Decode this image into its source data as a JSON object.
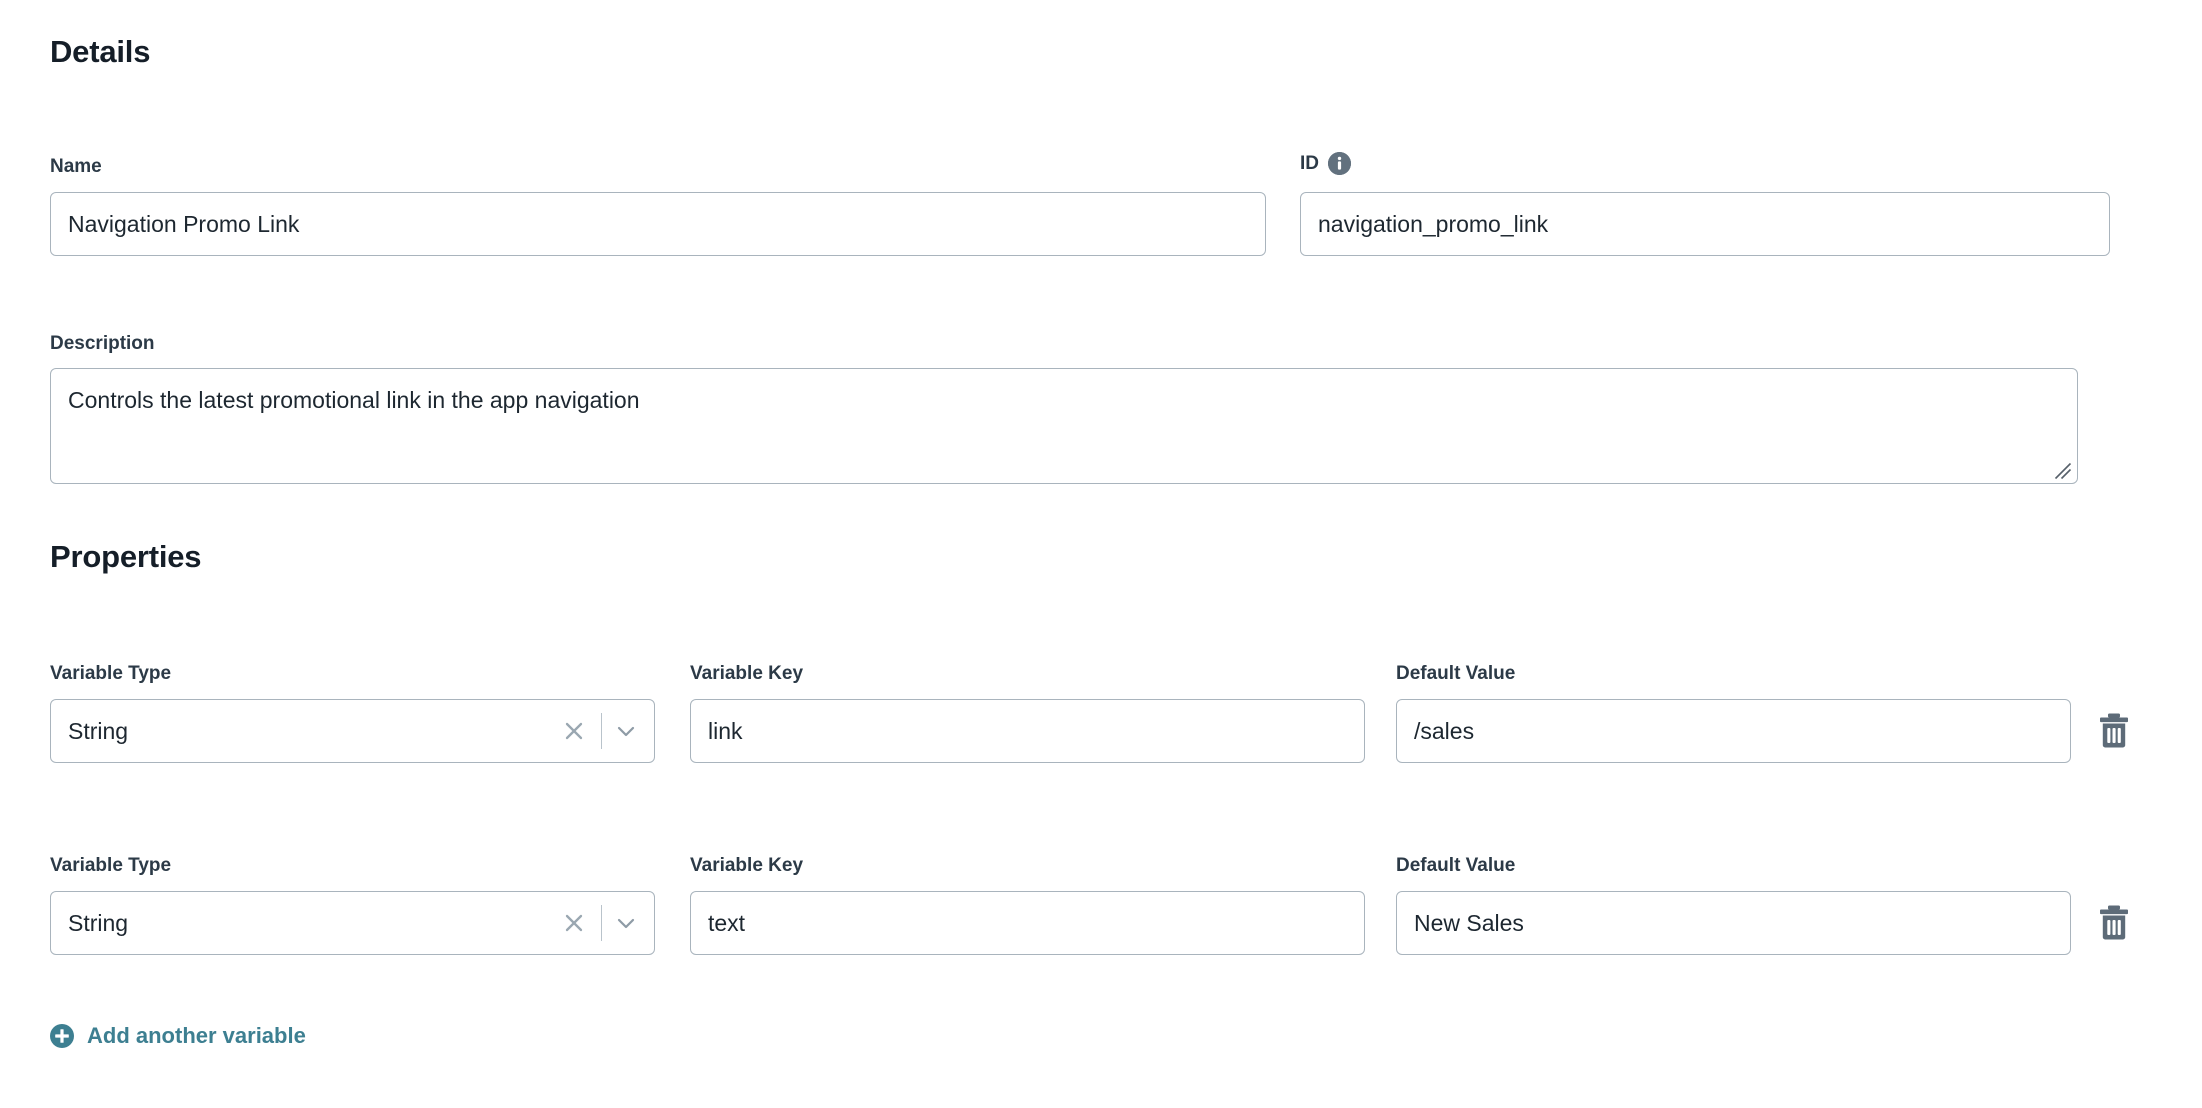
{
  "details": {
    "heading": "Details",
    "name": {
      "label": "Name",
      "value": "Navigation Promo Link",
      "placeholder": ""
    },
    "id": {
      "label": "ID",
      "value": "navigation_promo_link",
      "placeholder": "",
      "info_icon": "info-icon"
    },
    "description": {
      "label": "Description",
      "value": "Controls the latest promotional link in the app navigation",
      "placeholder": ""
    }
  },
  "properties": {
    "heading": "Properties",
    "column_labels": {
      "variable_type": "Variable Type",
      "variable_key": "Variable Key",
      "default_value": "Default Value"
    },
    "rows": [
      {
        "variable_type": "String",
        "variable_key": "link",
        "default_value": "/sales",
        "clear_icon": "close-icon",
        "caret_icon": "chevron-down-icon",
        "delete_icon": "trash-icon"
      },
      {
        "variable_type": "String",
        "variable_key": "text",
        "default_value": "New Sales",
        "clear_icon": "close-icon",
        "caret_icon": "chevron-down-icon",
        "delete_icon": "trash-icon"
      }
    ],
    "add_variable": {
      "label": "Add another variable",
      "icon": "plus-circle-icon"
    }
  },
  "colors": {
    "heading": "#151e28",
    "label": "#2c3a47",
    "input_border": "#a9b4bd",
    "input_text": "#1d2730",
    "accent_link": "#3d7f91",
    "icon_muted": "#5d6b78",
    "info_badge": "#62717e"
  }
}
